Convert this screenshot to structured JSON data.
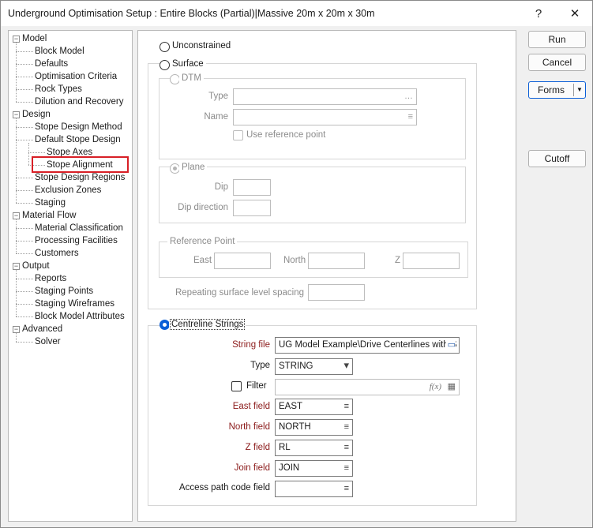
{
  "window": {
    "title": "Underground Optimisation Setup : Entire Blocks (Partial)|Massive 20m x 20m x 30m",
    "help_label": "?",
    "close_label": "✕"
  },
  "tree": {
    "collapse_glyph": "−",
    "items": [
      {
        "label": "Model",
        "level": 0
      },
      {
        "label": "Block Model",
        "level": 1
      },
      {
        "label": "Defaults",
        "level": 1
      },
      {
        "label": "Optimisation Criteria",
        "level": 1
      },
      {
        "label": "Rock Types",
        "level": 1
      },
      {
        "label": "Dilution and Recovery",
        "level": 1
      },
      {
        "label": "Design",
        "level": 0
      },
      {
        "label": "Stope Design Method",
        "level": 1
      },
      {
        "label": "Default Stope Design",
        "level": 1
      },
      {
        "label": "Stope Axes",
        "level": 2
      },
      {
        "label": "Stope Alignment",
        "level": 2,
        "selected": true
      },
      {
        "label": "Stope Design Regions",
        "level": 1
      },
      {
        "label": "Exclusion Zones",
        "level": 1
      },
      {
        "label": "Staging",
        "level": 1
      },
      {
        "label": "Material Flow",
        "level": 0
      },
      {
        "label": "Material Classification",
        "level": 1
      },
      {
        "label": "Processing Facilities",
        "level": 1
      },
      {
        "label": "Customers",
        "level": 1
      },
      {
        "label": "Output",
        "level": 0
      },
      {
        "label": "Reports",
        "level": 1
      },
      {
        "label": "Staging Points",
        "level": 1
      },
      {
        "label": "Staging Wireframes",
        "level": 1
      },
      {
        "label": "Block Model Attributes",
        "level": 1
      },
      {
        "label": "Advanced",
        "level": 0
      },
      {
        "label": "Solver",
        "level": 1
      }
    ]
  },
  "options": {
    "unconstrained_label": "Unconstrained",
    "surface_label": "Surface",
    "centreline_label": "Centreline Strings"
  },
  "dtm": {
    "label": "DTM",
    "type_label": "Type",
    "type_value": "",
    "name_label": "Name",
    "name_value": "",
    "use_ref_label": "Use reference point"
  },
  "plane": {
    "label": "Plane",
    "dip_label": "Dip",
    "dip_value": "",
    "dipdir_label": "Dip direction",
    "dipdir_value": ""
  },
  "reference_point": {
    "label": "Reference Point",
    "east_label": "East",
    "east_value": "",
    "north_label": "North",
    "north_value": "",
    "z_label": "Z",
    "z_value": ""
  },
  "repeating": {
    "label": "Repeating surface level spacing",
    "value": ""
  },
  "centreline": {
    "string_file_label": "String file",
    "string_file_value": "UG Model Example\\Drive Centerlines with S",
    "type_label": "Type",
    "type_value": "STRING",
    "filter_label": "Filter",
    "filter_value": "",
    "filter_fx": "f(x)",
    "east_field_label": "East field",
    "east_field_value": "EAST",
    "north_field_label": "North field",
    "north_field_value": "NORTH",
    "z_field_label": "Z field",
    "z_field_value": "RL",
    "join_field_label": "Join field",
    "join_field_value": "JOIN",
    "access_label": "Access path code field",
    "access_value": ""
  },
  "buttons": {
    "run": "Run",
    "cancel": "Cancel",
    "forms": "Forms",
    "cutoff": "Cutoff"
  },
  "icons": {
    "list": "≡",
    "browse": "…",
    "dropdown": "▾",
    "calendar": "▭",
    "grid": "▦"
  },
  "colors": {
    "accent": "#0a5ed7",
    "required_label": "#8b1a1a",
    "selection_box": "#d81f26"
  }
}
